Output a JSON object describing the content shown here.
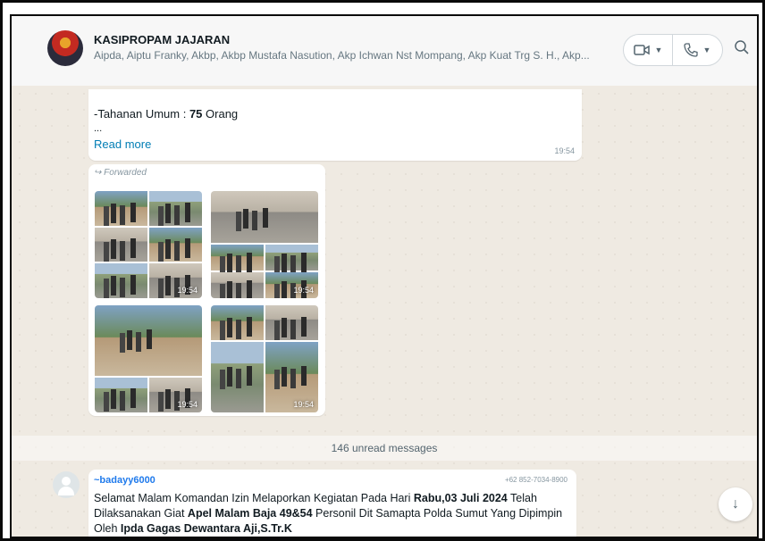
{
  "header": {
    "title": "KASIPROPAM JAJARAN",
    "subtitle": "Aipda, Aiptu Franky, Akbp, Akbp Mustafa Nasution, Akp Ichwan Nst Mompang, Akp Kuat Trg S. H., Akp...",
    "video_icon": "video-camera-icon",
    "voice_icon": "phone-icon",
    "search_icon": "search-icon"
  },
  "messages": [
    {
      "line": "-Tahanan Umum : ",
      "line_bold": "75",
      "line_suffix": " Orang",
      "ellipsis": "...",
      "read_more": "Read more",
      "time": "19:54"
    }
  ],
  "album": {
    "forwarded": "Forwarded",
    "tiles": [
      {
        "time": "19:54"
      },
      {
        "time": "19:54"
      },
      {
        "time": "19:54"
      },
      {
        "time": "19:54"
      }
    ]
  },
  "unread_label": "146 unread messages",
  "incoming": {
    "sender": "~badayy6000",
    "phone": "+62 852-7034-8900",
    "t1": "Selamat Malam Komandan Izin Melaporkan Kegiatan Pada Hari ",
    "b1": "Rabu,03 Juli 2024",
    "t2": " Telah Dilaksanakan Giat ",
    "b2": "Apel Malam Baja 49&54",
    "t3": " Personil Dit Samapta Polda Sumut Yang Dipimpin Oleh ",
    "b3": "Ipda Gagas Dewantara Aji,S.Tr.K"
  },
  "scroll_down_icon": "arrow-down-icon"
}
